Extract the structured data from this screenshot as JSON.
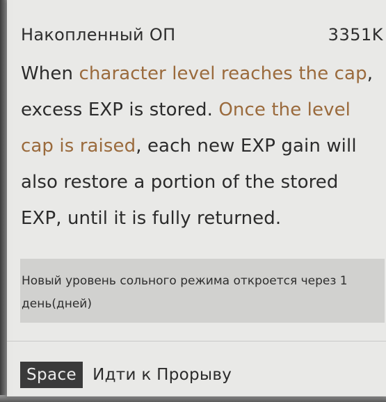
{
  "header": {
    "label": "Накопленный ОП",
    "value": "3351K"
  },
  "description": {
    "part1": "When ",
    "highlight1": "character level reaches the cap",
    "part2": ", excess EXP is stored. ",
    "highlight2": "Once the level cap is raised",
    "part3": ", each new EXP gain will also restore a portion of the stored EXP, until it is fully returned."
  },
  "notice": {
    "text": "Новый уровень сольного режима откроется через 1 день(дней)"
  },
  "footer": {
    "key": "Space",
    "action": "Идти к Прорыву"
  },
  "colors": {
    "highlight": "#9a6a3c",
    "panel": "#e9e9e7",
    "notice_bg": "#cccccA",
    "key_badge": "#3a3a3a"
  }
}
